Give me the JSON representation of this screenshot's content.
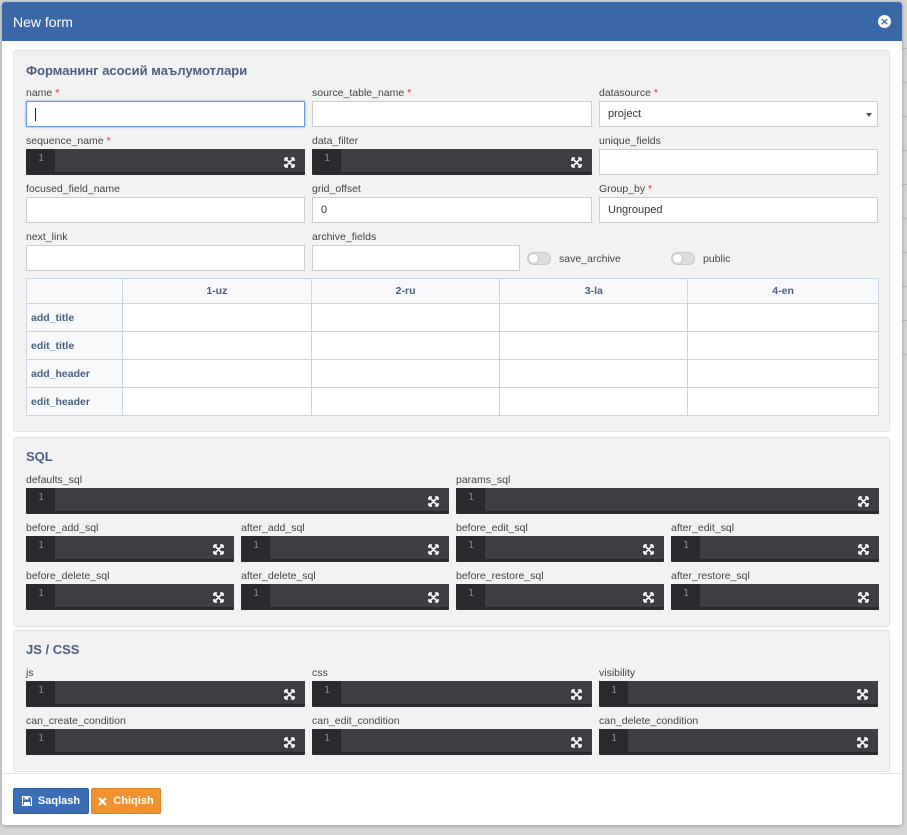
{
  "modal": {
    "title": "New form"
  },
  "basic": {
    "title": "Форманинг асосий маълумотлари",
    "name": {
      "label": "name",
      "value": ""
    },
    "source_table_name": {
      "label": "source_table_name",
      "value": ""
    },
    "datasource": {
      "label": "datasource",
      "value": "project"
    },
    "sequence_name": {
      "label": "sequence_name",
      "line": "1"
    },
    "data_filter": {
      "label": "data_filter",
      "line": "1"
    },
    "unique_fields": {
      "label": "unique_fields",
      "value": ""
    },
    "focused_field_name": {
      "label": "focused_field_name",
      "value": ""
    },
    "grid_offset": {
      "label": "grid_offset",
      "value": "0"
    },
    "group_by": {
      "label": "Group_by",
      "value": "Ungrouped"
    },
    "next_link": {
      "label": "next_link",
      "value": ""
    },
    "archive_fields": {
      "label": "archive_fields",
      "value": ""
    },
    "save_archive": {
      "label": "save_archive",
      "on": false
    },
    "public": {
      "label": "public",
      "on": false
    },
    "required_mark": "*"
  },
  "lang_table": {
    "columns": [
      "1-uz",
      "2-ru",
      "3-la",
      "4-en"
    ],
    "rows": [
      "add_title",
      "edit_title",
      "add_header",
      "edit_header"
    ]
  },
  "sql": {
    "title": "SQL",
    "defaults_sql": "defaults_sql",
    "params_sql": "params_sql",
    "before_add_sql": "before_add_sql",
    "after_add_sql": "after_add_sql",
    "before_edit_sql": "before_edit_sql",
    "after_edit_sql": "after_edit_sql",
    "before_delete_sql": "before_delete_sql",
    "after_delete_sql": "after_delete_sql",
    "before_restore_sql": "before_restore_sql",
    "after_restore_sql": "after_restore_sql"
  },
  "jscss": {
    "title": "JS / CSS",
    "js": "js",
    "css": "css",
    "visibility": "visibility",
    "can_create_condition": "can_create_condition",
    "can_edit_condition": "can_edit_condition",
    "can_delete_condition": "can_delete_condition"
  },
  "editor_line_number": "1",
  "footer": {
    "save_label": "Saqlash",
    "exit_label": "Chiqish"
  },
  "colors": {
    "header": "#3a68a7",
    "save": "#3a6fb7",
    "exit": "#f0932e",
    "editor": "#282a2e"
  }
}
